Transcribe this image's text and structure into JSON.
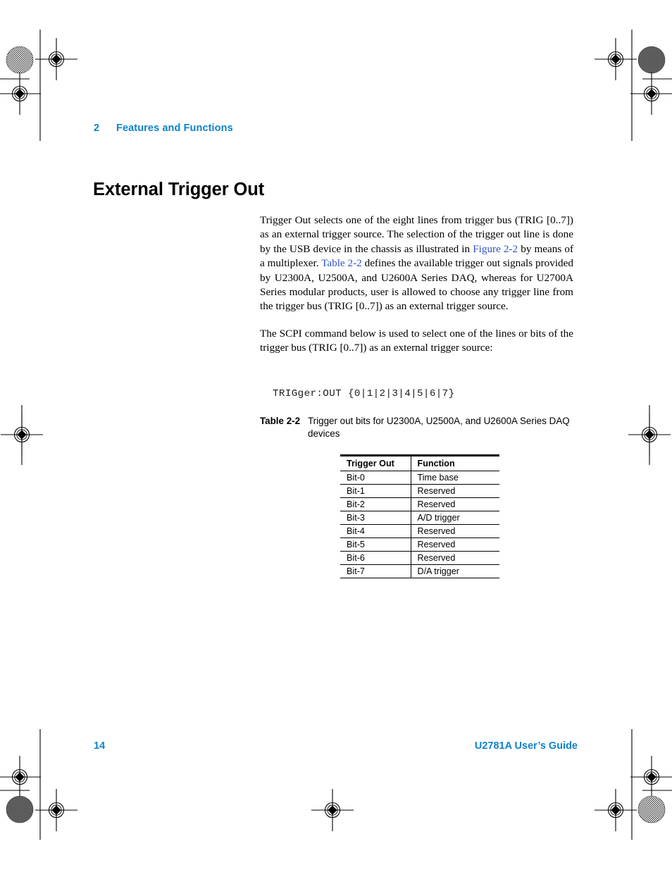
{
  "document": {
    "running_header": {
      "chapter_number": "2",
      "chapter_title": "Features and Functions"
    },
    "section_title": "External Trigger Out",
    "paragraphs": {
      "p1_a": "Trigger Out selects one of the eight lines from trigger bus (TRIG [0..7]) as an external trigger source. The selection of the trigger out line is done by the USB device in the chassis as illustrated in ",
      "p1_xref1": "Figure 2-2",
      "p1_b": " by means of a multiplexer. ",
      "p1_xref2": "Table 2-2",
      "p1_c": " defines the available trigger out signals provided by U2300A, U2500A, and U2600A Series DAQ, whereas for U2700A Series modular products, user is allowed to choose any trigger line from the trigger bus (TRIG [0..7]) as an external trigger source.",
      "p2": "The SCPI command below is used to select one of the lines or bits of the trigger bus (TRIG [0..7]) as an external trigger source:"
    },
    "code_sample": "TRIGger:OUT {0|1|2|3|4|5|6|7}",
    "table_caption": {
      "label": "Table 2-2",
      "text": "Trigger out bits for U2300A, U2500A, and U2600A Series DAQ devices"
    },
    "table": {
      "headers": [
        "Trigger Out",
        "Function"
      ],
      "rows": [
        [
          "Bit-0",
          "Time base"
        ],
        [
          "Bit-1",
          "Reserved"
        ],
        [
          "Bit-2",
          "Reserved"
        ],
        [
          "Bit-3",
          "A/D trigger"
        ],
        [
          "Bit-4",
          "Reserved"
        ],
        [
          "Bit-5",
          "Reserved"
        ],
        [
          "Bit-6",
          "Reserved"
        ],
        [
          "Bit-7",
          "D/A trigger"
        ]
      ]
    },
    "footer": {
      "page_number": "14",
      "guide_title": "U2781A User’s Guide"
    },
    "colors": {
      "heading_blue": "#0e82cb",
      "xref_blue": "#2e52c8",
      "text_black": "#000000"
    }
  }
}
